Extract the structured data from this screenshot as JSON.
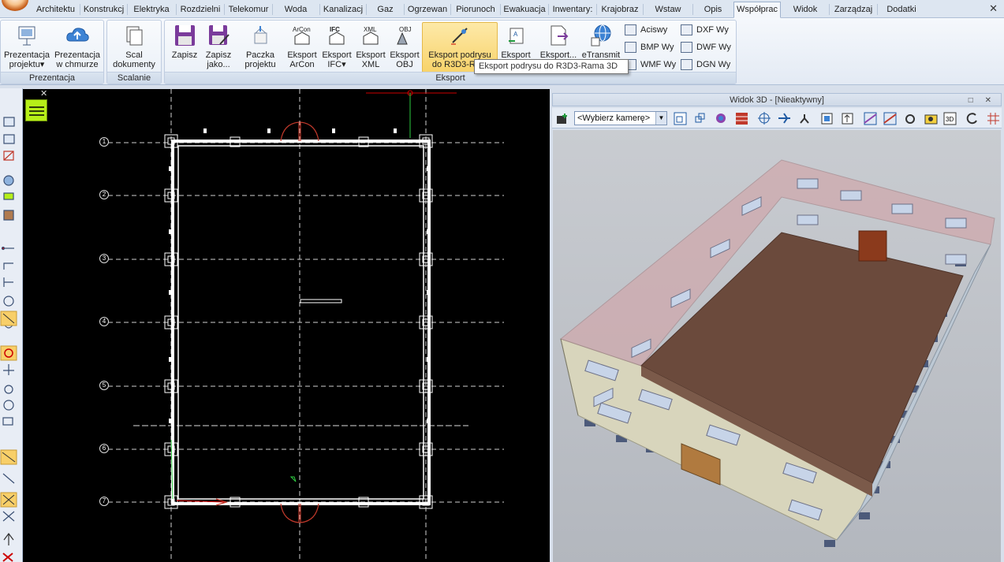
{
  "tabs": [
    "Architektu",
    "Konstrukcj",
    "Elektryka",
    "Rozdzielni",
    "Telekomur",
    "Woda",
    "Kanalizacj",
    "Gaz",
    "Ogrzewan",
    "Piorunoch",
    "Ewakuacja",
    "Inwentary:",
    "Krajobraz",
    "Wstaw",
    "Opis",
    "Współprac",
    "Widok",
    "Zarządzaj",
    "Dodatki"
  ],
  "active_tab": "Współprac",
  "window_close": "✕",
  "ribbon": {
    "groups": {
      "prezentacja": {
        "label": "Prezentacja",
        "btn1_l1": "Prezentacja",
        "btn1_l2": "projektu▾",
        "btn2_l1": "Prezentacja",
        "btn2_l2": "w chmurze"
      },
      "scalanie": {
        "label": "Scalanie",
        "btn1_l1": "Scal",
        "btn1_l2": "dokumenty"
      },
      "eksport": {
        "label": "Eksport",
        "zapisz": "Zapisz",
        "zapisz_jako_l1": "Zapisz",
        "zapisz_jako_l2": "jako...",
        "paczka_l1": "Paczka",
        "paczka_l2": "projektu",
        "arcon_l1": "Eksport",
        "arcon_l2": "ArCon",
        "ifc_l1": "Eksport",
        "ifc_l2": "IFC▾",
        "xml_l1": "Eksport",
        "xml_l2": "XML",
        "obj_l1": "Eksport",
        "obj_l2": "OBJ",
        "r3d3_l1": "Eksport podrysu",
        "r3d3_l2": "do R3D3-Ram",
        "eksport_at": "Eksport",
        "eksport_dots": "Eksport...",
        "etransmit": "eTransmit",
        "aciswy": "Aciswy",
        "bmpwy": "BMP Wy",
        "wmfwy": "WMF Wy",
        "dxfwy": "DXF Wy",
        "dwfwy": "DWF Wy",
        "dgnwy": "DGN Wy"
      }
    }
  },
  "tooltip": "Eksport podrysu do R3D3-Rama 3D",
  "cad": {
    "axis_labels": [
      "1",
      "2",
      "3",
      "4",
      "5",
      "6",
      "7"
    ]
  },
  "view3d": {
    "title": "Widok 3D - [Nieaktywny]",
    "window_buttons": "□ ✕",
    "camera_select": "<Wybierz kamerę>"
  },
  "colors": {
    "ribbon_bg": "#e3eaf4",
    "highlight": "#f8d36b",
    "cad_bg": "#000000",
    "roof": "#6b4a3c",
    "wall": "#d8d5bc"
  }
}
